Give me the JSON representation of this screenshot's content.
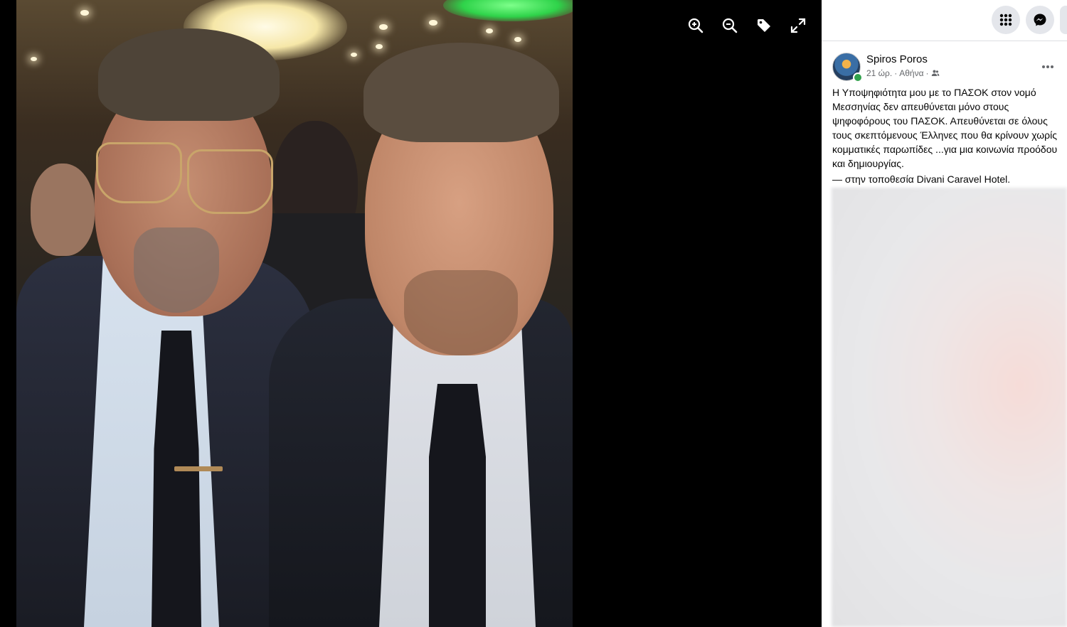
{
  "viewer": {
    "toolbar": {
      "zoom_in_icon": "zoom-in-icon",
      "zoom_out_icon": "zoom-out-icon",
      "tag_icon": "tag-icon",
      "fullscreen_icon": "fullscreen-icon"
    },
    "photo_alt": "Two men in suits posing for a selfie at an event"
  },
  "topbar": {
    "menu_icon": "grid-menu-icon",
    "messenger_icon": "messenger-icon"
  },
  "post": {
    "author": "Spiros Poros",
    "time": "21 ώρ.",
    "separator": "·",
    "place": "Αθήνα",
    "separator2": "·",
    "audience_icon": "friends-audience-icon",
    "text": "Η Υποψηφιότητα μου με το ΠΑΣΟΚ στον νομό Μεσσηνίας δεν απευθύνεται μόνο στους ψηφοφόρους του ΠΑΣΟΚ. Απευθύνεται σε όλους τους σκεπτόμενους Έλληνες που θα κρίνουν χωρίς κομματικές παρωπίδες ...για μια κοινωνία προόδου και δημιουργίας.",
    "location_prefix": "— στην τοποθεσία",
    "location_name": "Divani Caravel Hotel",
    "location_suffix": "."
  },
  "colors": {
    "viewer_bg": "#000000",
    "sidebar_bg": "#ffffff",
    "online": "#31a24c",
    "meta_text": "#65676b"
  }
}
